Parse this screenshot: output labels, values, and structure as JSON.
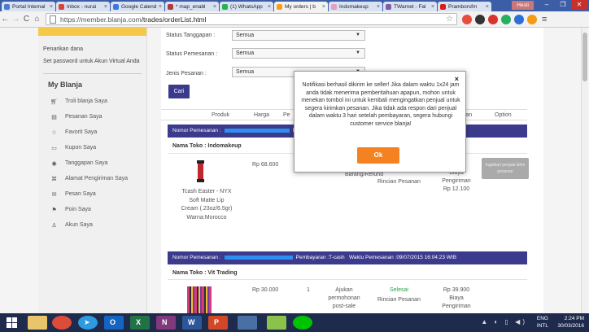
{
  "browser": {
    "tabs": [
      {
        "label": "Portal Internal",
        "color": "#4a7bd0"
      },
      {
        "label": "Inbox - nurai",
        "color": "#d44638"
      },
      {
        "label": "Google Calend",
        "color": "#3b78e7"
      },
      {
        "label": "* map_enabl",
        "color": "#b23a3a"
      },
      {
        "label": "(1) WhatsApp",
        "color": "#2ab24f"
      },
      {
        "label": "My orders | b",
        "color": "#f6a01a",
        "active": true
      },
      {
        "label": "Indomakeup",
        "color": "#e5a0c0"
      },
      {
        "label": "TWarnet - Fal",
        "color": "#7b5ea7"
      },
      {
        "label": "Pramborsfm",
        "color": "#d91e18"
      }
    ],
    "user": "Hesti",
    "url_host": "https://member.blanja.com",
    "url_path": "/trades/orderList.html"
  },
  "sidebar": {
    "link1": "Penarikan dana",
    "link2": "Set password untuk Akun Virtual Anda",
    "title": "My Blanja",
    "items": [
      {
        "label": "Troli blanja Saya"
      },
      {
        "label": "Pesanan Saya"
      },
      {
        "label": "Favorit Saya"
      },
      {
        "label": "Kupon Saya"
      },
      {
        "label": "Tanggapan Saya"
      },
      {
        "label": "Alamat Pengiriman Saya"
      },
      {
        "label": "Pesan Saya"
      },
      {
        "label": "Poin Saya"
      },
      {
        "label": "Akun Saya"
      }
    ]
  },
  "filters": {
    "tanggal_label": "Status Tanggapan :",
    "tanggal_value": "Semua",
    "pemesanan_label": "Status Pemesanan :",
    "pemesanan_value": "Semua",
    "jenis_label": "Jenis Pesanan :",
    "jenis_value": "Semua",
    "search_button": "Cari"
  },
  "table": {
    "headers": {
      "produk": "Produk",
      "harga": "Harga",
      "jumlah": "Pe",
      "status": "ran",
      "option": "Option"
    },
    "order1": {
      "bar_label": "Nomor Pemesanan :",
      "bar_tail": "Pe",
      "store": "Nama Toko : Indomakeup",
      "product": [
        "Tcash Easter - NYX",
        "Soft Matte Lip",
        "Cream (.23oz/6.5gr)",
        "Warna:Morocco"
      ],
      "price": "Rp 68.600",
      "action": "Barang/Refund",
      "detail": "Rincian Pesanan",
      "ship": [
        "Biaya",
        "Pengiriman",
        "Rp 12.100"
      ],
      "option_btn": "Ingatkan penjual kirim pesanan"
    },
    "order2": {
      "bar_label": "Nomor Pemesanan :",
      "bar_payment": "Pembayaran :T-cash",
      "bar_time": "Waktu Pemesanan :09/07/2015 16:04:23 WIB",
      "store": "Nama Toko : Vit Trading",
      "price": "Rp 30.000",
      "qty": "1",
      "action": [
        "Ajukan",
        "permohonan",
        "post-sale"
      ],
      "status": "Selesai",
      "detail": "Rincian Pesanan",
      "ship": [
        "Rp 39.900",
        "Biaya",
        "Pengiriman"
      ]
    }
  },
  "modal": {
    "message": "Notifikasi berhasil dikirim ke seller! Jika dalam waktu 1x24 jam anda tidak menerima pemberitahuan apapun, mohon untuk menekan tombol ini untuk kembali mengingatkan penjual untuk segera kirimkan pesanan. Jika tidak ada respon dari penjual dalam waktu 3 hari setelah pembayaran, segera hubungi customer service blanja!",
    "ok_label": "Ok",
    "close_glyph": "×"
  },
  "taskbar": {
    "lang": "ENG",
    "region": "INTL",
    "time": "2:24 PM",
    "date": "30/03/2016"
  }
}
